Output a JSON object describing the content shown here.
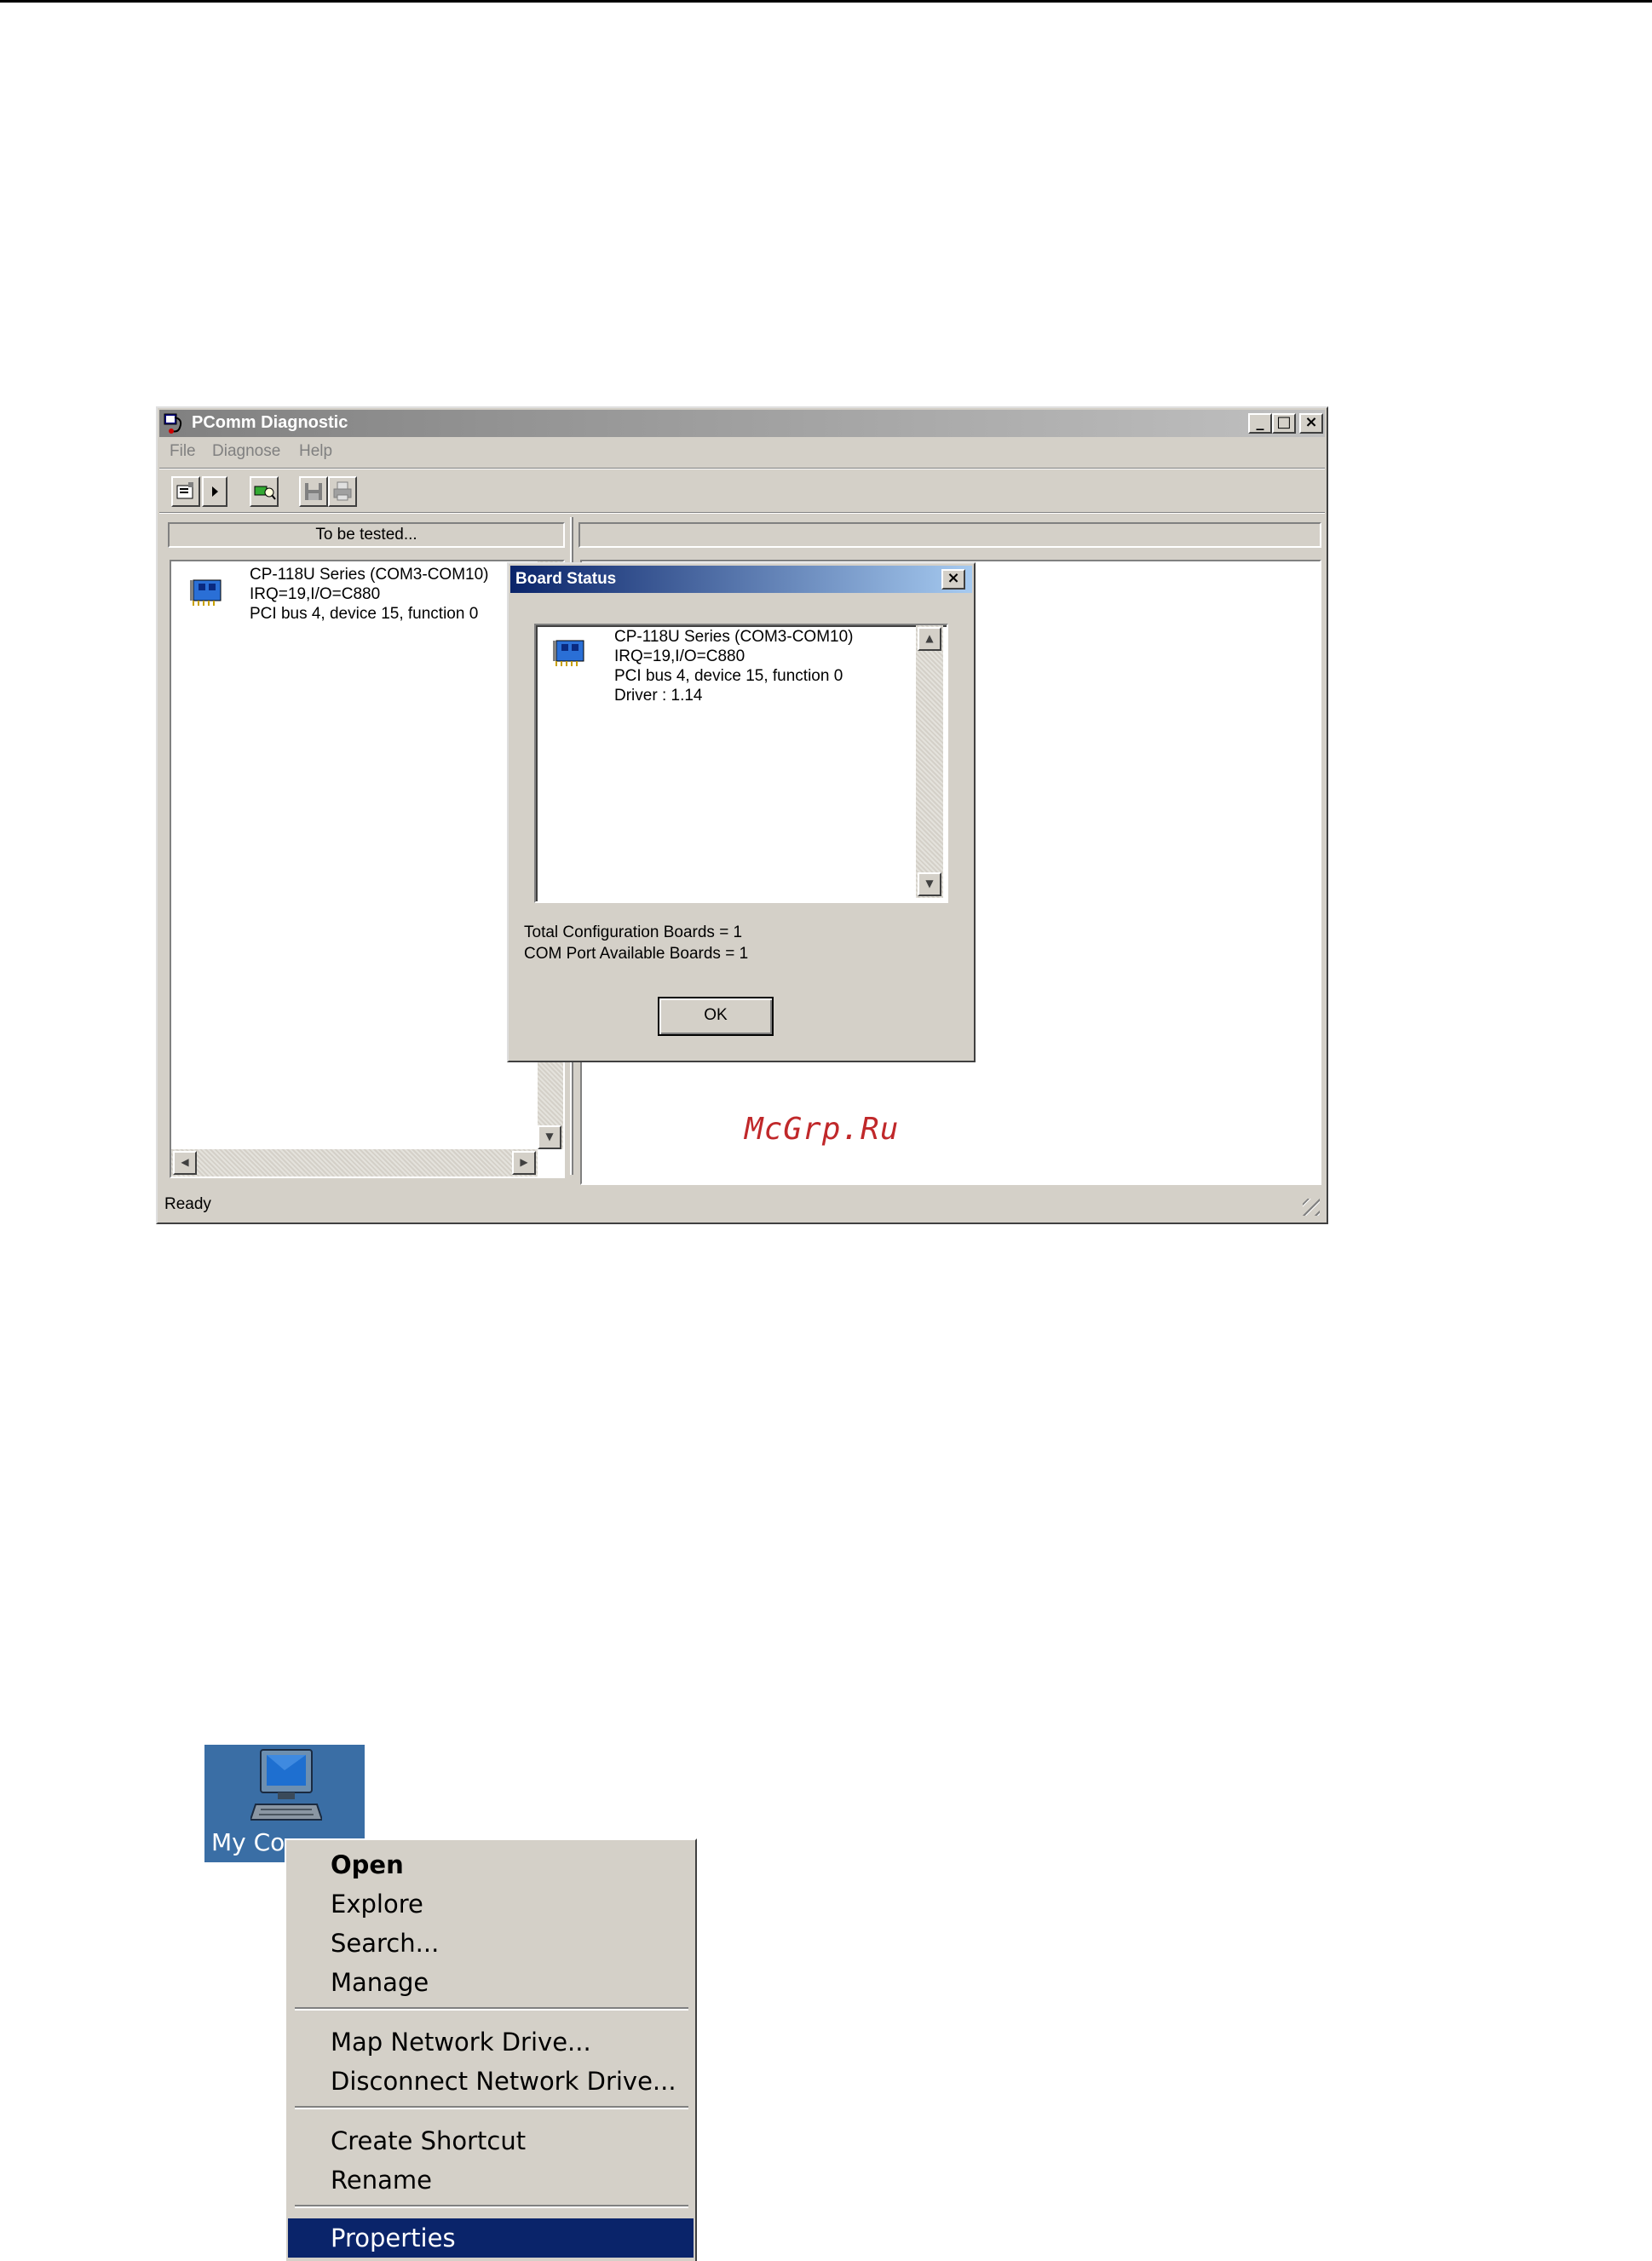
{
  "window": {
    "title": "PComm Diagnostic",
    "menu": [
      "File",
      "Diagnose",
      "Help"
    ],
    "controls": {
      "minimize": "_",
      "maximize": "□",
      "close": "×"
    },
    "left_header": "To be tested...",
    "right_header": "",
    "board": {
      "name": "CP-118U Series  (COM3-COM10)",
      "irq": "IRQ=19,I/O=C880",
      "bus": "PCI bus 4, device 15, function 0"
    },
    "status": "Ready"
  },
  "dialog": {
    "title": "Board Status",
    "close": "×",
    "board": {
      "name": "CP-118U Series  (COM3-COM10)",
      "irq": "IRQ=19,I/O=C880",
      "bus": "PCI bus 4, device 15, function 0",
      "driver": "Driver : 1.14"
    },
    "total_boards": "Total Configuration Boards = 1",
    "available_boards": "COM Port Available Boards = 1",
    "ok_label": "OK"
  },
  "watermark": "McGrp.Ru",
  "desktop_icon": {
    "label": "My Co"
  },
  "context_menu": {
    "items": [
      {
        "label": "Open"
      },
      {
        "label": "Explore"
      },
      {
        "label": "Search..."
      },
      {
        "label": "Manage"
      },
      {
        "label": "Map Network Drive..."
      },
      {
        "label": "Disconnect Network Drive..."
      },
      {
        "label": "Create Shortcut"
      },
      {
        "label": "Rename"
      },
      {
        "label": "Properties"
      }
    ]
  },
  "colors": {
    "window_bg": "#d4d0c8",
    "selection": "#0a246a",
    "desktop": "#3a6ea5",
    "watermark": "#c0282a"
  }
}
